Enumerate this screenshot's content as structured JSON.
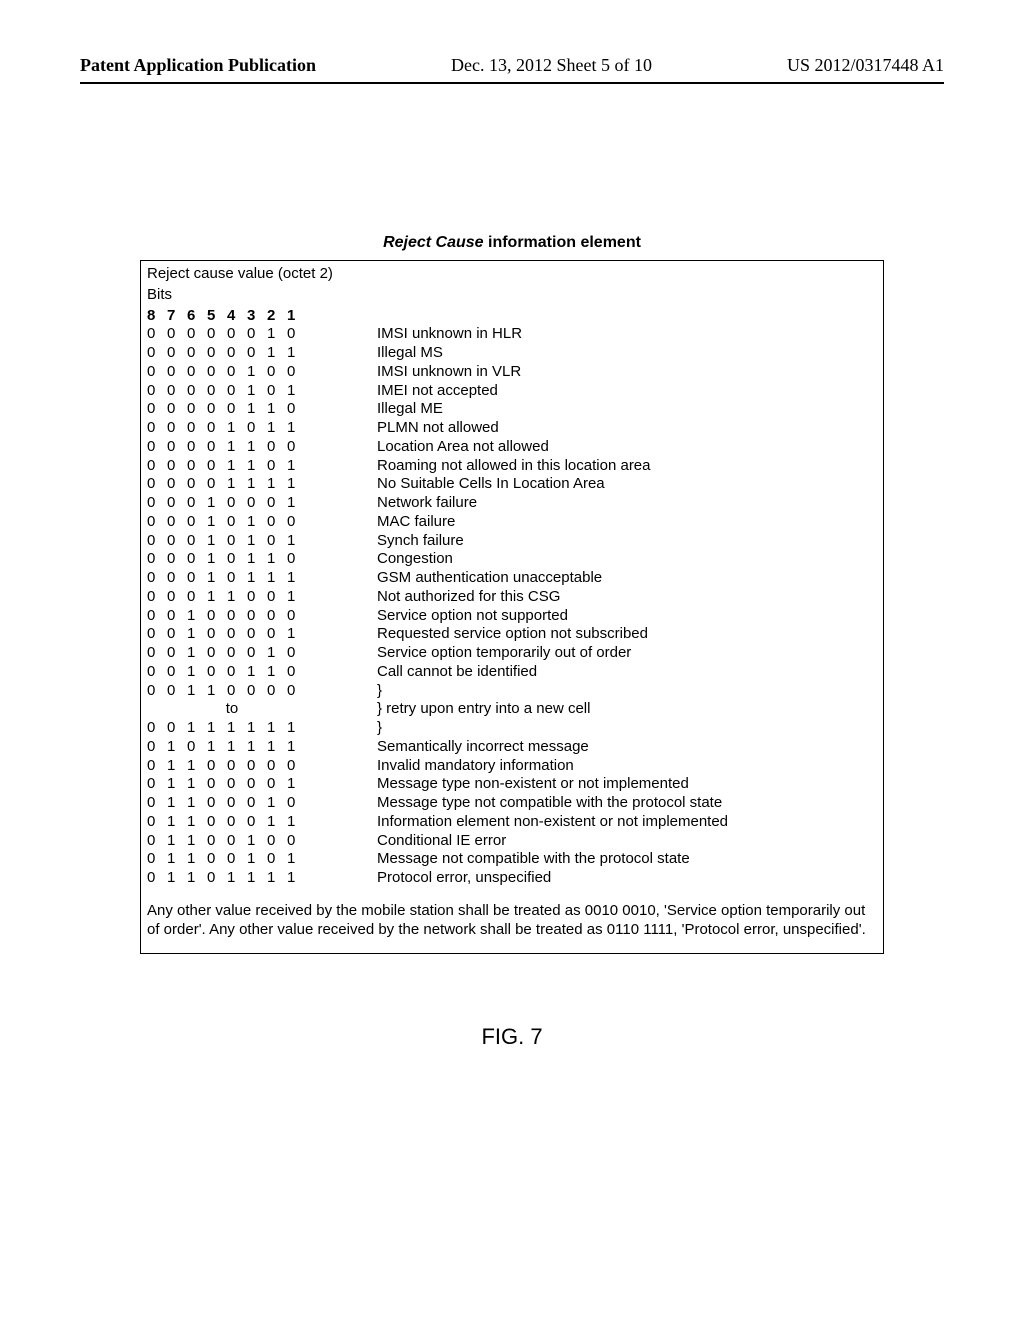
{
  "header": {
    "left": "Patent Application Publication",
    "mid": "Dec. 13, 2012  Sheet 5 of 10",
    "right": "US 2012/0317448 A1"
  },
  "caption": {
    "italic": "Reject Cause",
    "bold": " information element"
  },
  "table": {
    "top1": "Reject cause value (octet 2)",
    "top2": "Bits",
    "bits_header": [
      "8",
      "7",
      "6",
      "5",
      "4",
      "3",
      "2",
      "1"
    ],
    "rows": [
      {
        "b": [
          "0",
          "0",
          "0",
          "0",
          "0",
          "0",
          "1",
          "0"
        ],
        "d": "IMSI unknown in HLR"
      },
      {
        "b": [
          "0",
          "0",
          "0",
          "0",
          "0",
          "0",
          "1",
          "1"
        ],
        "d": "Illegal MS"
      },
      {
        "b": [
          "0",
          "0",
          "0",
          "0",
          "0",
          "1",
          "0",
          "0"
        ],
        "d": "IMSI unknown in VLR"
      },
      {
        "b": [
          "0",
          "0",
          "0",
          "0",
          "0",
          "1",
          "0",
          "1"
        ],
        "d": "IMEI not accepted"
      },
      {
        "b": [
          "0",
          "0",
          "0",
          "0",
          "0",
          "1",
          "1",
          "0"
        ],
        "d": "Illegal ME"
      },
      {
        "b": [
          "0",
          "0",
          "0",
          "0",
          "1",
          "0",
          "1",
          "1"
        ],
        "d": "PLMN not allowed"
      },
      {
        "b": [
          "0",
          "0",
          "0",
          "0",
          "1",
          "1",
          "0",
          "0"
        ],
        "d": "Location Area not allowed"
      },
      {
        "b": [
          "0",
          "0",
          "0",
          "0",
          "1",
          "1",
          "0",
          "1"
        ],
        "d": "Roaming not allowed in this location area"
      },
      {
        "b": [
          "0",
          "0",
          "0",
          "0",
          "1",
          "1",
          "1",
          "1"
        ],
        "d": "No Suitable Cells In Location Area"
      },
      {
        "b": [
          "0",
          "0",
          "0",
          "1",
          "0",
          "0",
          "0",
          "1"
        ],
        "d": "Network failure"
      },
      {
        "b": [
          "0",
          "0",
          "0",
          "1",
          "0",
          "1",
          "0",
          "0"
        ],
        "d": "MAC failure"
      },
      {
        "b": [
          "0",
          "0",
          "0",
          "1",
          "0",
          "1",
          "0",
          "1"
        ],
        "d": "Synch failure"
      },
      {
        "b": [
          "0",
          "0",
          "0",
          "1",
          "0",
          "1",
          "1",
          "0"
        ],
        "d": "Congestion"
      },
      {
        "b": [
          "0",
          "0",
          "0",
          "1",
          "0",
          "1",
          "1",
          "1"
        ],
        "d": "GSM authentication unacceptable"
      },
      {
        "b": [
          "0",
          "0",
          "0",
          "1",
          "1",
          "0",
          "0",
          "1"
        ],
        "d": "Not authorized for this CSG"
      },
      {
        "b": [
          "0",
          "0",
          "1",
          "0",
          "0",
          "0",
          "0",
          "0"
        ],
        "d": "Service option not supported"
      },
      {
        "b": [
          "0",
          "0",
          "1",
          "0",
          "0",
          "0",
          "0",
          "1"
        ],
        "d": "Requested service option not subscribed"
      },
      {
        "b": [
          "0",
          "0",
          "1",
          "0",
          "0",
          "0",
          "1",
          "0"
        ],
        "d": "Service option temporarily out of order"
      },
      {
        "b": [
          "0",
          "0",
          "1",
          "0",
          "0",
          "1",
          "1",
          "0"
        ],
        "d": "Call cannot be identified"
      },
      {
        "b": [
          "0",
          "0",
          "1",
          "1",
          "0",
          "0",
          "0",
          "0"
        ],
        "d": "}"
      }
    ],
    "to_label": "to",
    "to_desc": "} retry upon entry into a new cell",
    "rows2": [
      {
        "b": [
          "0",
          "0",
          "1",
          "1",
          "1",
          "1",
          "1",
          "1"
        ],
        "d": "}"
      },
      {
        "b": [
          "0",
          "1",
          "0",
          "1",
          "1",
          "1",
          "1",
          "1"
        ],
        "d": "Semantically incorrect message"
      },
      {
        "b": [
          "0",
          "1",
          "1",
          "0",
          "0",
          "0",
          "0",
          "0"
        ],
        "d": "Invalid mandatory information"
      },
      {
        "b": [
          "0",
          "1",
          "1",
          "0",
          "0",
          "0",
          "0",
          "1"
        ],
        "d": "Message type non-existent or not implemented"
      },
      {
        "b": [
          "0",
          "1",
          "1",
          "0",
          "0",
          "0",
          "1",
          "0"
        ],
        "d": "Message type not compatible with the protocol state"
      },
      {
        "b": [
          "0",
          "1",
          "1",
          "0",
          "0",
          "0",
          "1",
          "1"
        ],
        "d": "Information element non-existent or not implemented"
      },
      {
        "b": [
          "0",
          "1",
          "1",
          "0",
          "0",
          "1",
          "0",
          "0"
        ],
        "d": "Conditional IE error"
      },
      {
        "b": [
          "0",
          "1",
          "1",
          "0",
          "0",
          "1",
          "0",
          "1"
        ],
        "d": "Message not compatible with the protocol state"
      },
      {
        "b": [
          "0",
          "1",
          "1",
          "0",
          "1",
          "1",
          "1",
          "1"
        ],
        "d": "Protocol error, unspecified"
      }
    ],
    "footnote": "Any other value received by the mobile station shall be treated as 0010 0010, 'Service option temporarily out of order'. Any other value received by the network shall be treated as 0110 1111, 'Protocol error, unspecified'."
  },
  "figure_label": "FIG. 7"
}
